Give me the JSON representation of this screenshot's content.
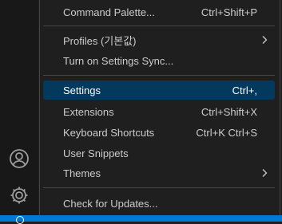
{
  "menu": {
    "items": [
      {
        "label": "Command Palette...",
        "keybinding": "Ctrl+Shift+P"
      },
      {
        "label": "Profiles (기본값)",
        "keybinding": "",
        "submenu": true
      },
      {
        "label": "Turn on Settings Sync...",
        "keybinding": ""
      },
      {
        "label": "Settings",
        "keybinding": "Ctrl+,",
        "selected": true
      },
      {
        "label": "Extensions",
        "keybinding": "Ctrl+Shift+X"
      },
      {
        "label": "Keyboard Shortcuts",
        "keybinding": "Ctrl+K Ctrl+S"
      },
      {
        "label": "User Snippets",
        "keybinding": ""
      },
      {
        "label": "Themes",
        "keybinding": "",
        "submenu": true
      },
      {
        "label": "Check for Updates...",
        "keybinding": ""
      }
    ]
  },
  "activity_bar": {
    "icons": [
      "accounts-icon",
      "manage-gear-icon"
    ]
  },
  "colors": {
    "menu_background": "#1f1f1f",
    "selected_background": "#04395e",
    "status_bar": "#0078d4",
    "text": "#cccccc"
  }
}
